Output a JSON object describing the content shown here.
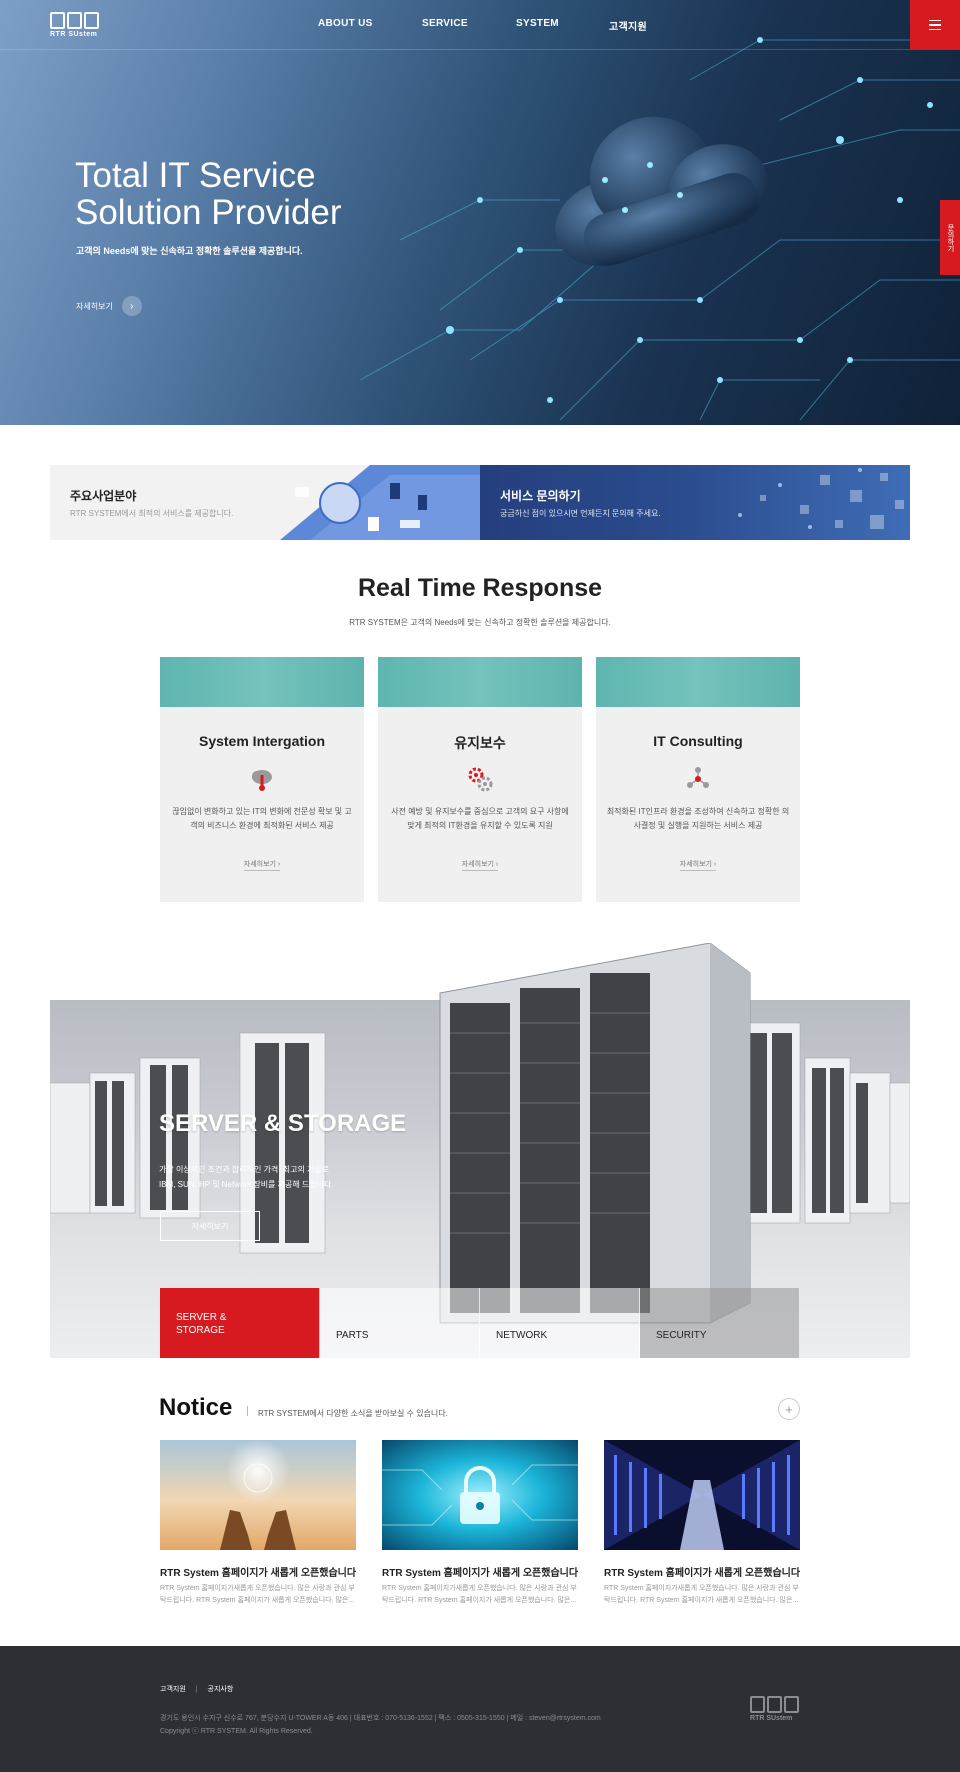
{
  "header": {
    "logo_text": "RTR SUstem",
    "nav": [
      "ABOUT US",
      "SERVICE",
      "SYSTEM",
      "고객지원"
    ],
    "side_tab": "문의하기"
  },
  "hero": {
    "title": "Total IT Service Solution Provider",
    "subtitle": "고객의 Needs에 맞는 신속하고 정확한 솔루션을 제공합니다.",
    "more": "자세히보기"
  },
  "banners": {
    "left": {
      "title": "주요사업분야",
      "desc": "RTR SYSTEM에서 최적의 서비스를 제공합니다."
    },
    "right": {
      "title": "서비스 문의하기",
      "desc": "궁금하신 점이 있으시면 언제든지 문의해 주세요."
    }
  },
  "rtr": {
    "title": "Real Time Response",
    "subtitle": "RTR SYSTEM은 고객의 Needs에 맞는 신속하고 정확한 솔루션을 제공합니다.",
    "cards": [
      {
        "title": "System Intergation",
        "desc": "끊임없이 변화하고 있는 IT의 변화에 전문성 확보 및 고객의 비즈니스 환경에 최적화된 서비스 제공",
        "more": "자세히보기 ›",
        "icon": "cloud-thermometer-icon"
      },
      {
        "title": "유지보수",
        "desc": "사전 예방 및 유지보수를 중심으로 고객의 요구 사항에 맞게 최적의 IT환경을 유지할 수 있도록 지원",
        "more": "자세히보기 ›",
        "icon": "gears-icon"
      },
      {
        "title": "IT Consulting",
        "desc": "최적화된 IT인프라 환경을 조성하여 신속하고 정확한 의사결정 및 실행을 지원하는 서비스 제공",
        "more": "자세히보기 ›",
        "icon": "network-people-icon"
      }
    ]
  },
  "server": {
    "title": "SERVER & STORAGE",
    "desc_line1": "가장 이상적인 조건과 합리적인 가격, 최고의 기술로",
    "desc_line2": "IBM, SUN, HP 및 Network 장비를 제공해 드립니다.",
    "button": "자세히보기",
    "tabs": [
      "SERVER & STORAGE",
      "PARTS",
      "NETWORK",
      "SECURITY"
    ]
  },
  "notice": {
    "title": "Notice",
    "subtitle": "RTR SYSTEM에서 다양한 소식을 받아보실 수 있습니다.",
    "plus": "+",
    "items": [
      {
        "title": "RTR System 홈페이지가 새롭게 오픈했습니다.",
        "desc": "RTR System 홈페이지가새롭게 오픈했습니다. 많은 사랑과 관심 부탁드립니다.  RTR System 홈페이지가 새롭게 오픈했습니다. 많은..."
      },
      {
        "title": "RTR System 홈페이지가 새롭게 오픈했습니다.",
        "desc": "RTR System 홈페이지가새롭게 오픈했습니다. 많은 사랑과 관심 부탁드립니다.  RTR System 홈페이지가 새롭게 오픈했습니다. 많은..."
      },
      {
        "title": "RTR System 홈페이지가 새롭게 오픈했습니다.",
        "desc": "RTR System 홈페이지가새롭게 오픈했습니다. 많은 사랑과 관심 부탁드립니다.  RTR System 홈페이지가 새롭게 오픈했습니다. 많은..."
      }
    ]
  },
  "footer": {
    "link1": "고객지원",
    "link2": "공지사항",
    "address": "경기도 용인시 수지구 신수로 767, 분당수지 U-TOWER A동 406  |  대표번호 : 070-5136-1552  |  팩스 : 0505-315-1550 | 메일 : steven@rtrsystem.com",
    "copyright": "Copyright ⓒ RTR SYSTEM. All Rights Reserved.",
    "logo_text": "RTR SUstem"
  },
  "colors": {
    "accent": "#d71920",
    "footer_bg": "#2c2f33",
    "card_teal": "#6bbcb6"
  }
}
